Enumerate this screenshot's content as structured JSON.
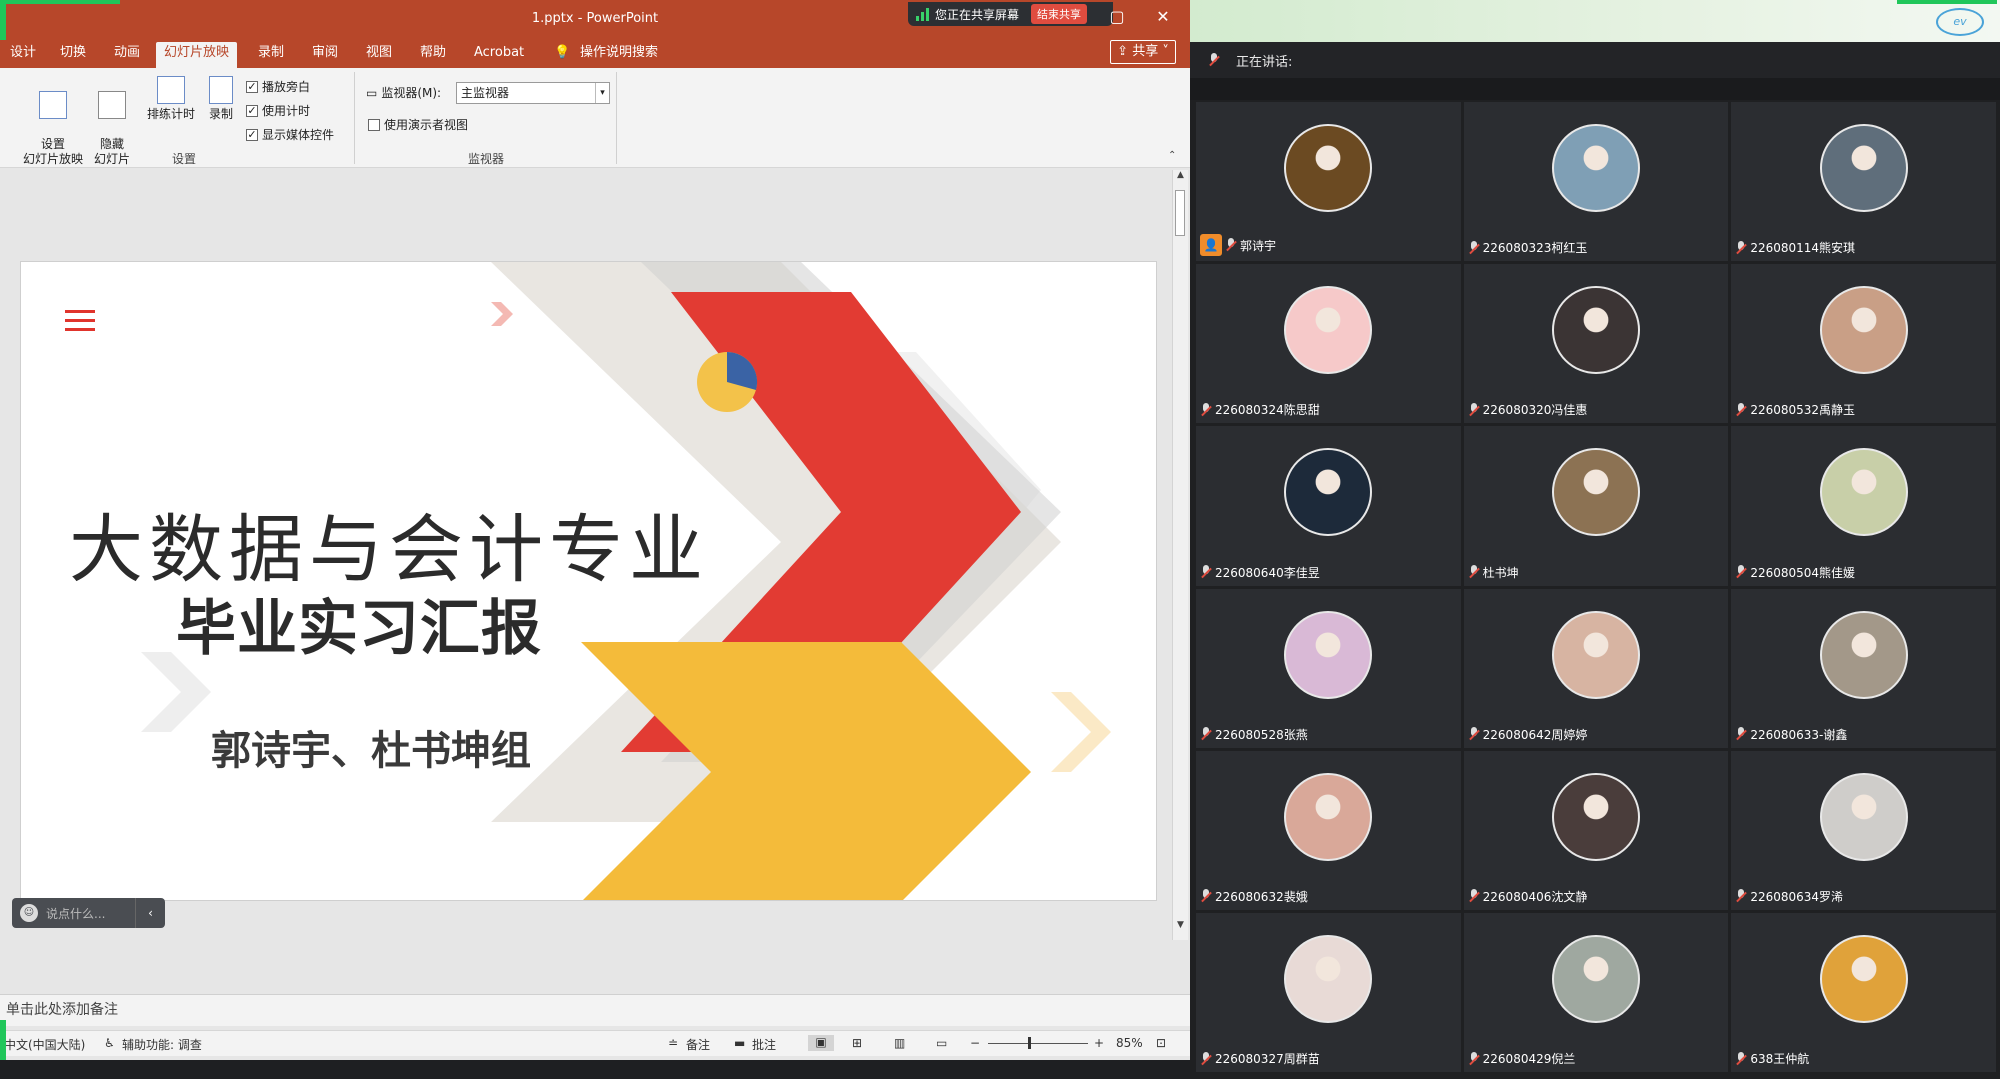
{
  "window": {
    "title": "1.pptx  -  PowerPoint"
  },
  "share_banner": {
    "text": "您正在共享屏幕",
    "end_label": "结束共享"
  },
  "ribbon_tabs": [
    {
      "label": "设计",
      "active": false
    },
    {
      "label": "切换",
      "active": false
    },
    {
      "label": "动画",
      "active": false
    },
    {
      "label": "幻灯片放映",
      "active": true
    },
    {
      "label": "录制",
      "active": false
    },
    {
      "label": "审阅",
      "active": false
    },
    {
      "label": "视图",
      "active": false
    },
    {
      "label": "帮助",
      "active": false
    },
    {
      "label": "Acrobat",
      "active": false
    },
    {
      "label": "操作说明搜索",
      "active": false
    }
  ],
  "share_button": "共享",
  "ribbon": {
    "setup_slideshow": "设置\n幻灯片放映",
    "hide_slide": "隐藏\n幻灯片",
    "rehearse": "排练计时",
    "record": "录制",
    "play_narration": "播放旁白",
    "use_timings": "使用计时",
    "show_media_controls": "显示媒体控件",
    "group_setup": "设置",
    "monitor_label": "监视器(M):",
    "monitor_value": "主监视器",
    "presenter_view": "使用演示者视图",
    "group_monitor": "监视器"
  },
  "slide": {
    "title": "大数据与会计专业",
    "subtitle": "毕业实习汇报",
    "group": "郭诗宇、杜书坤组"
  },
  "comment_box": {
    "placeholder": "说点什么..."
  },
  "notes_placeholder": "单击此处添加备注",
  "status": {
    "language": "中文(中国大陆)",
    "accessibility": "辅助功能: 调查",
    "notes": "备注",
    "comments": "批注",
    "zoom": "85%"
  },
  "meeting": {
    "speaking_label": "正在讲话:",
    "participants": [
      {
        "name": "郭诗宇",
        "host": true,
        "avatar": "#6b4a22"
      },
      {
        "name": "226080323柯红玉",
        "host": false,
        "avatar": "#7f9fb5"
      },
      {
        "name": "226080114熊安琪",
        "host": false,
        "avatar": "#5f6e7b"
      },
      {
        "name": "226080324陈思甜",
        "host": false,
        "avatar": "#f6c9c9"
      },
      {
        "name": "226080320冯佳惠",
        "host": false,
        "avatar": "#3b3434"
      },
      {
        "name": "226080532禹静玉",
        "host": false,
        "avatar": "#c99f86"
      },
      {
        "name": "226080640李佳昱",
        "host": false,
        "avatar": "#1d2a3a"
      },
      {
        "name": "杜书坤",
        "host": false,
        "avatar": "#8c7253"
      },
      {
        "name": "226080504熊佳媛",
        "host": false,
        "avatar": "#c8cfa8"
      },
      {
        "name": "226080528张燕",
        "host": false,
        "avatar": "#d9b9d6"
      },
      {
        "name": "226080642周婷婷",
        "host": false,
        "avatar": "#d7b4a2"
      },
      {
        "name": "226080633-谢鑫",
        "host": false,
        "avatar": "#a39889"
      },
      {
        "name": "226080632裴娥",
        "host": false,
        "avatar": "#d9a899"
      },
      {
        "name": "226080406沈文静",
        "host": false,
        "avatar": "#4a3d3b"
      },
      {
        "name": "226080634罗浠",
        "host": false,
        "avatar": "#cfcdca"
      },
      {
        "name": "226080327周群苗",
        "host": false,
        "avatar": "#e8dad6"
      },
      {
        "name": "226080429倪兰",
        "host": false,
        "avatar": "#9fa8a0"
      },
      {
        "name": "638王仲航",
        "host": false,
        "avatar": "#e0a23a"
      }
    ]
  },
  "colors": {
    "ppt_accent": "#b7472a",
    "slide_red": "#e23b33",
    "slide_yellow": "#f4bb3a",
    "meeting_bg": "#1f2022"
  }
}
